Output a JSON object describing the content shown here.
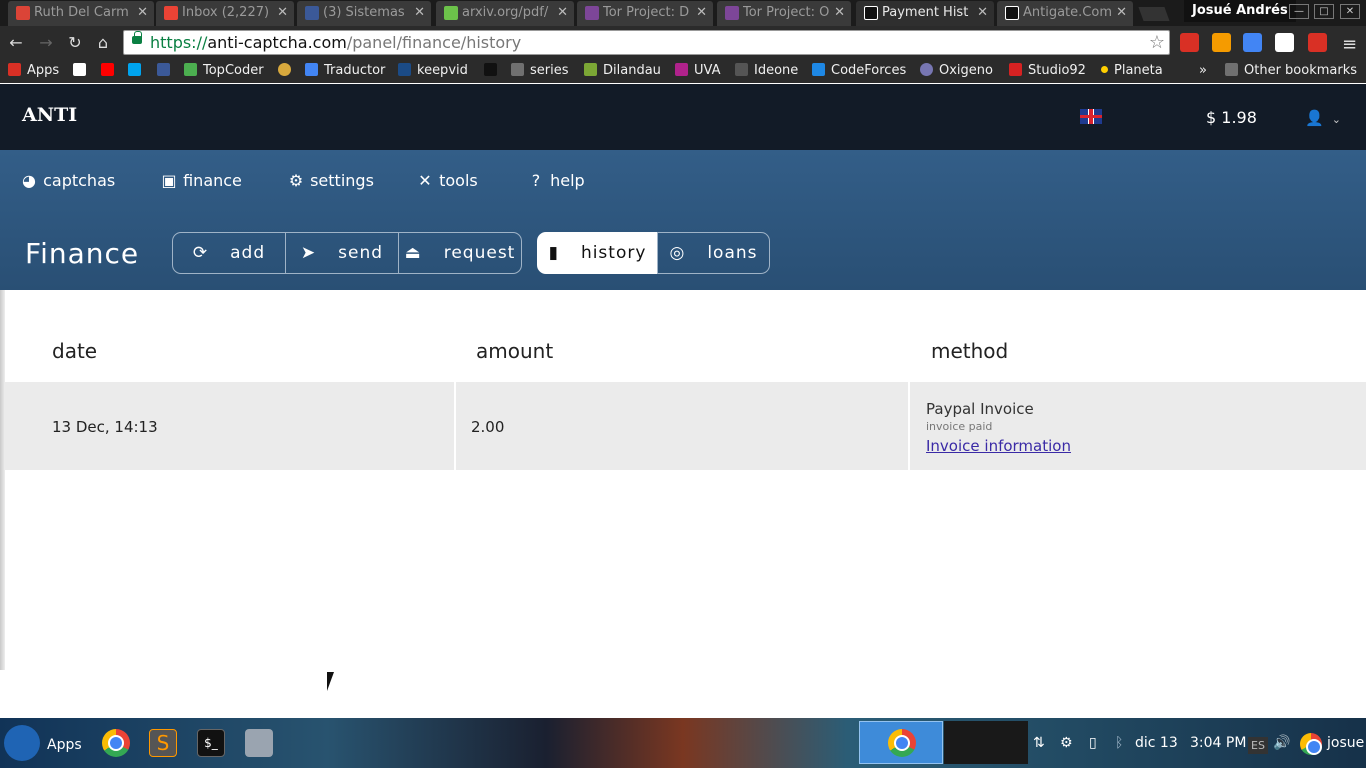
{
  "browser": {
    "tabs": [
      {
        "label": "Ruth Del Carm",
        "color": "#db4437"
      },
      {
        "label": "Inbox (2,227)",
        "color": "#ea4335"
      },
      {
        "label": "(3) Sistemas",
        "color": "#3b5998"
      },
      {
        "label": "arxiv.org/pdf/",
        "color": "#6cc24a"
      },
      {
        "label": "Tor Project: D",
        "color": "#7d4698"
      },
      {
        "label": "Tor Project: O",
        "color": "#7d4698"
      },
      {
        "label": "Payment Hist",
        "color": "#111111"
      },
      {
        "label": "Antigate.Com",
        "color": "#111111"
      }
    ],
    "profile": "Josué Andrés",
    "url": {
      "protocol": "https://",
      "host": "anti-captcha.com",
      "path": "/panel/finance/history"
    },
    "bookmarks": [
      {
        "label": "Apps",
        "color": "#d93025"
      },
      {
        "label": "",
        "color": "#ffffff"
      },
      {
        "label": "",
        "color": "#ff0000"
      },
      {
        "label": "",
        "color": "#00a4ef"
      },
      {
        "label": "",
        "color": "#3b5998"
      },
      {
        "label": "TopCoder",
        "color": "#4caf50"
      },
      {
        "label": "",
        "color": "#d8a93d"
      },
      {
        "label": "Traductor",
        "color": "#4285f4"
      },
      {
        "label": "keepvid",
        "color": "#1b4b86"
      },
      {
        "label": "",
        "color": "#111111"
      },
      {
        "label": "series",
        "color": "#707070"
      },
      {
        "label": "Dilandau",
        "color": "#7ca735"
      },
      {
        "label": "UVA",
        "color": "#b0228c"
      },
      {
        "label": "Ideone",
        "color": "#555555"
      },
      {
        "label": "CodeForces",
        "color": "#1e88e5"
      },
      {
        "label": "Oxigeno",
        "color": "#7776b2"
      },
      {
        "label": "Studio92",
        "color": "#d62222"
      },
      {
        "label": "Planeta",
        "color": "#ffcf00"
      }
    ],
    "overflow": "»",
    "other_bookmarks": "Other bookmarks"
  },
  "site": {
    "logo": "ANTI",
    "balance": "$ 1.98",
    "nav": [
      "captchas",
      "finance",
      "settings",
      "tools",
      "help"
    ],
    "page_title": "Finance",
    "actions": [
      "add",
      "send",
      "request"
    ],
    "views": [
      "history",
      "loans"
    ]
  },
  "table": {
    "headers": {
      "date": "date",
      "amount": "amount",
      "method": "method"
    },
    "row": {
      "date": "13 Dec, 14:13",
      "amount": "2.00",
      "method": "Paypal Invoice",
      "status": "invoice paid",
      "link": "Invoice information"
    }
  },
  "taskbar": {
    "apps": "Apps",
    "language": "ES",
    "date": "dic 13",
    "time": "3:04 PM",
    "user": "josue"
  },
  "colors": {
    "header": "#121b27",
    "hero": "#335e88",
    "link": "#3a2aa6"
  }
}
